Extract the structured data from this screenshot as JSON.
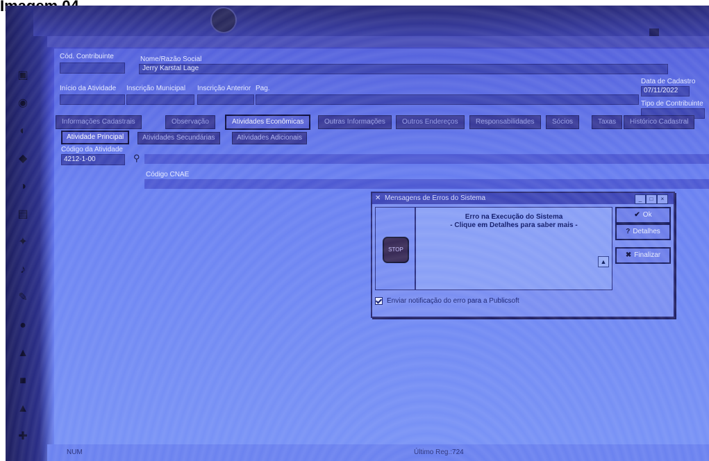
{
  "caption": "Imagem 04.",
  "form": {
    "cod_contribuinte_label": "Cód. Contribuinte",
    "nome_razao_label": "Nome/Razão Social",
    "nome_value": "Jerry Karstal Lage",
    "inicio_atividade_label": "Início da Atividade",
    "inscricao_municipal_label": "Inscrição Municipal",
    "inscricao_anterior_label": "Inscrição Anterior",
    "pag_label": "Pag.",
    "data_cadastro_label": "Data de Cadastro",
    "data_cadastro_value": "07/11/2022",
    "tipo_contribuinte_label": "Tipo de Contribuinte"
  },
  "tabs": [
    {
      "label": "Informações Cadastrais",
      "active": false
    },
    {
      "label": "Observação",
      "active": false
    },
    {
      "label": "Atividades Econômicas",
      "active": true
    },
    {
      "label": "Outras Informações",
      "active": false
    },
    {
      "label": "Outros Endereços",
      "active": false
    },
    {
      "label": "Responsabilidades",
      "active": false
    },
    {
      "label": "Sócios",
      "active": false
    },
    {
      "label": "Taxas",
      "active": false
    },
    {
      "label": "Histórico Cadastral",
      "active": false
    }
  ],
  "subtabs": [
    {
      "label": "Atividade Principal",
      "active": true
    },
    {
      "label": "Atividades Secundárias",
      "active": false
    },
    {
      "label": "Atividades Adicionais",
      "active": false
    }
  ],
  "atividade": {
    "codigo_label": "Código da Atividade",
    "codigo_value": "4212-1-00",
    "cnae_label": "Código CNAE"
  },
  "dialog": {
    "title": "Mensagens de Erros do Sistema",
    "line1": "Erro na Execução do Sistema",
    "line2": "- Clique em Detalhes para saber mais -",
    "stop_text": "STOP",
    "ok_label": "Ok",
    "detalhes_label": "Detalhes",
    "finalizar_label": "Finalizar",
    "checkbox_label": "Enviar notificação do erro para a Publicsoft"
  },
  "status": {
    "num": "NUM",
    "ultimo_reg": "Último Reg.:724"
  }
}
